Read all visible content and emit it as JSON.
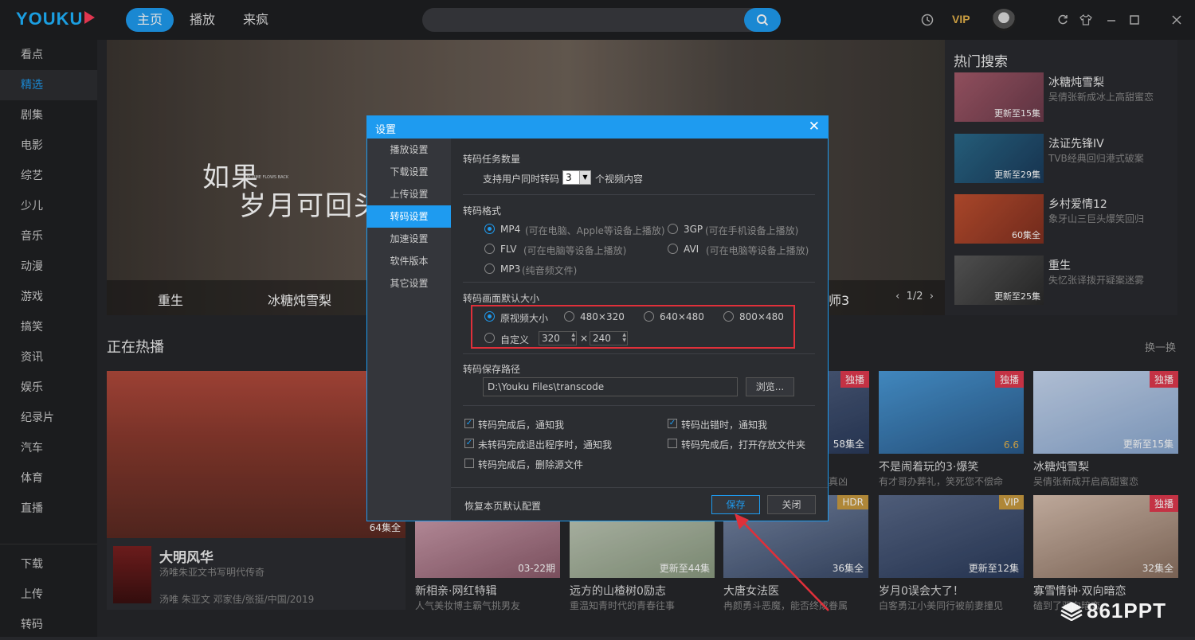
{
  "app": {
    "logo": "YOUKU"
  },
  "nav": {
    "tabs": [
      "主页",
      "播放",
      "来疯"
    ]
  },
  "toolbar": {
    "vip": "VIP"
  },
  "sidebar": {
    "items": [
      "看点",
      "精选",
      "剧集",
      "电影",
      "综艺",
      "少儿",
      "音乐",
      "动漫",
      "游戏",
      "搞笑",
      "资讯",
      "娱乐",
      "纪录片",
      "汽车",
      "体育",
      "直播"
    ],
    "bottom": [
      "下载",
      "上传",
      "转码"
    ]
  },
  "hero": {
    "title_line1": "如果",
    "title_line2": "岁月可回头",
    "subtitle": "IF TIME FLOWS BACK",
    "captions": [
      "重生",
      "冰糖炖雪梨",
      "师3"
    ],
    "pager": "1/2"
  },
  "hot": {
    "title": "热门搜索",
    "items": [
      {
        "title": "冰糖炖雪梨",
        "desc": "吴倩张新成冰上高甜蜜恋",
        "ep": "更新至15集"
      },
      {
        "title": "法证先锋IV",
        "desc": "TVB经典回归港式破案",
        "ep": "更新至29集"
      },
      {
        "title": "乡村爱情12",
        "desc": "象牙山三巨头爆笑回归",
        "ep": "60集全"
      },
      {
        "title": "重生",
        "desc": "失忆张译拨开疑案迷雾",
        "ep": "更新至25集"
      }
    ]
  },
  "section": {
    "title": "正在热播",
    "refresh": "换一换"
  },
  "big_card": {
    "ep": "64集全",
    "title": "大明风华",
    "desc": "汤唯朱亚文书写明代传奇",
    "meta": "汤唯 朱亚文 邓家佳/张挺/中国/2019"
  },
  "cards": [
    {
      "title": "不是闹着玩的3·爆笑",
      "desc": "有才哥办葬礼，笑死您不偿命",
      "ep": "6.6",
      "badge": "独播"
    },
    {
      "title": "冰糖炖雪梨",
      "desc": "吴倩张新成开启高甜蜜恋",
      "ep": "更新至15集",
      "badge": "独播"
    },
    {
      "title": "新相亲·网红特辑",
      "desc": "人气美妆博主霸气挑男友",
      "ep": "03-22期",
      "badge": ""
    },
    {
      "title": "远方的山楂树0励志",
      "desc": "重温知青时代的青春往事",
      "ep": "更新至44集",
      "badge": ""
    },
    {
      "title": "大唐女法医",
      "desc": "冉颜勇斗恶魔，能否终成眷属",
      "ep": "36集全",
      "badge": "HDR"
    },
    {
      "title": "岁月0误会大了！",
      "desc": "白客勇江小美同行被前妻撞见",
      "ep": "更新至12集",
      "badge": "VIP"
    },
    {
      "title": "寡雪情钟·双向暗恋",
      "desc": "磕到了双向暗恋",
      "ep": "32集全",
      "badge": "独播"
    }
  ],
  "partial_card": {
    "ep": "58集全",
    "badge": "独播",
    "desc_tail": "真凶"
  },
  "dialog": {
    "title": "设置",
    "nav": [
      "播放设置",
      "下载设置",
      "上传设置",
      "转码设置",
      "加速设置",
      "软件版本",
      "其它设置"
    ],
    "task_count": {
      "label": "转码任务数量",
      "prefix": "支持用户同时转码",
      "value": "3",
      "suffix": "个视频内容"
    },
    "format": {
      "label": "转码格式",
      "options": [
        {
          "name": "MP4",
          "hint": "(可在电脑、Apple等设备上播放)"
        },
        {
          "name": "3GP",
          "hint": "(可在手机设备上播放)"
        },
        {
          "name": "FLV",
          "hint": "(可在电脑等设备上播放)"
        },
        {
          "name": "AVI",
          "hint": "(可在电脑等设备上播放)"
        },
        {
          "name": "MP3",
          "hint": "(纯音频文件)"
        }
      ],
      "selected": "MP4"
    },
    "size": {
      "label": "转码画面默认大小",
      "options": [
        "原视频大小",
        "480×320",
        "640×480",
        "800×480"
      ],
      "custom": "自定义",
      "width": "320",
      "x": "×",
      "height": "240",
      "selected": "原视频大小"
    },
    "path": {
      "label": "转码保存路径",
      "value": "D:\\Youku Files\\transcode",
      "browse": "浏览..."
    },
    "checks": [
      {
        "label": "转码完成后，通知我",
        "checked": true
      },
      {
        "label": "转码出错时，通知我",
        "checked": true
      },
      {
        "label": "未转码完成退出程序时，通知我",
        "checked": true
      },
      {
        "label": "转码完成后，打开存放文件夹",
        "checked": false
      },
      {
        "label": "转码完成后，删除源文件",
        "checked": false
      }
    ],
    "footer": {
      "restore": "恢复本页默认配置",
      "save": "保存",
      "close": "关闭"
    }
  },
  "watermark": "861PPT",
  "colors": {
    "accent": "#1e9bf0",
    "highlight": "#e0303a",
    "badge": "#e0394e",
    "vip": "#e6b34a"
  }
}
